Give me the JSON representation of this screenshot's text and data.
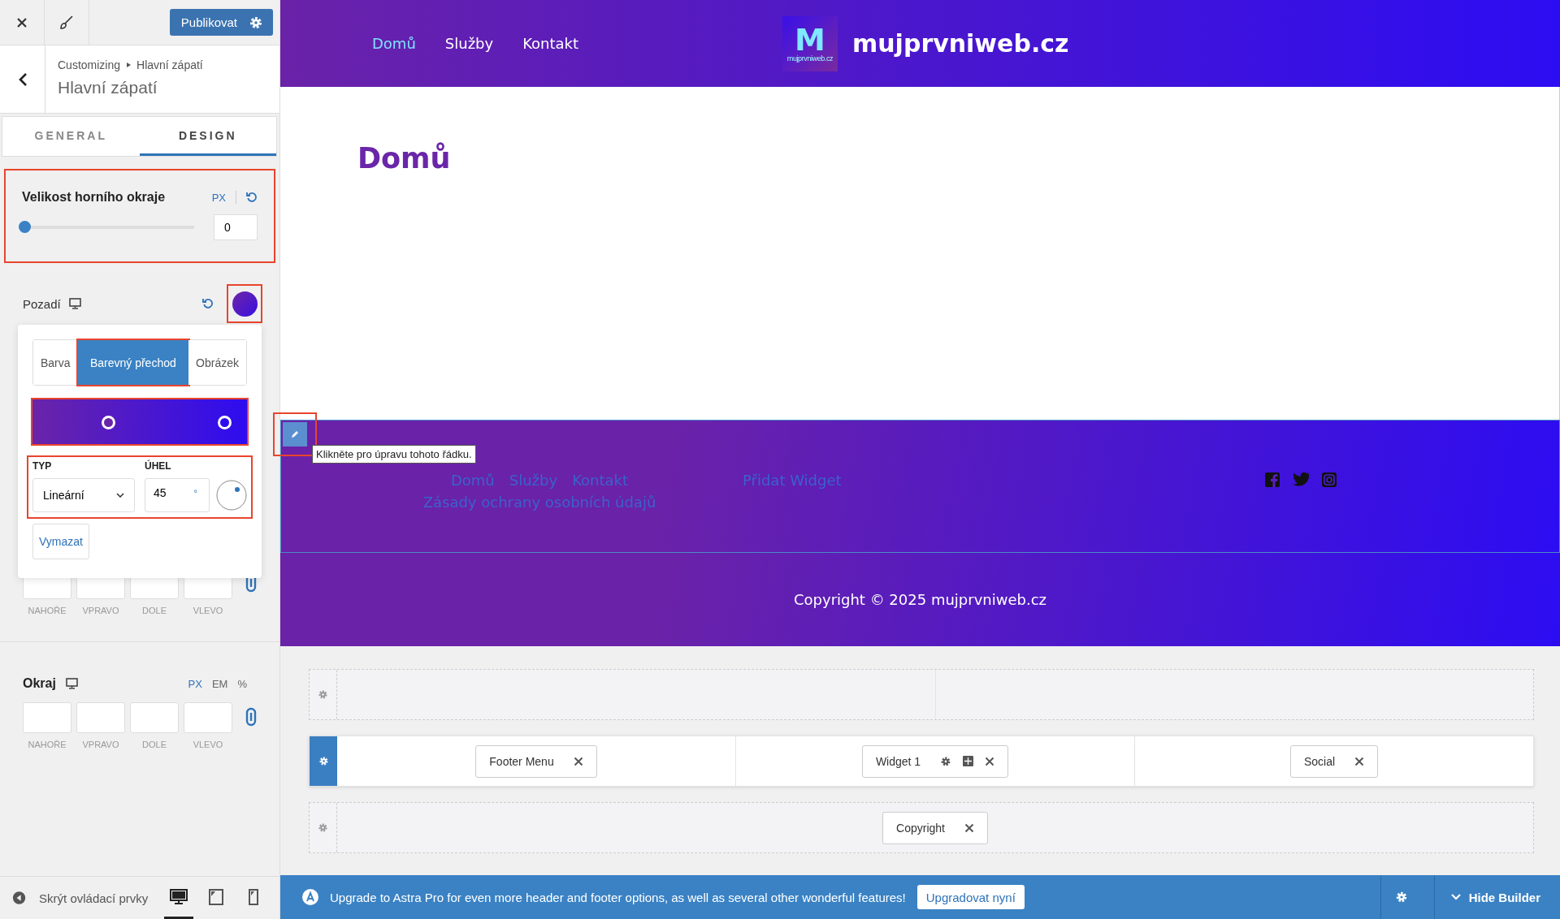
{
  "toolbar": {
    "publish_label": "Publikovat"
  },
  "breadcrumb": {
    "parent": "Customizing",
    "current": "Hlavní zápatí"
  },
  "title": "Hlavní zápatí",
  "tabs": [
    {
      "label": "GENERAL",
      "selected": false
    },
    {
      "label": "DESIGN",
      "selected": true
    }
  ],
  "border_size": {
    "label": "Velikost horního okraje",
    "unit": "PX",
    "value": "0",
    "level": 0,
    "highlighted": true
  },
  "background": {
    "label": "Pozadí",
    "swatch_highlighted": true
  },
  "color_popup": {
    "tabs": [
      {
        "label": "Barva",
        "selected": false,
        "highlighted": false
      },
      {
        "label": "Barevný přechod",
        "selected": true,
        "highlighted": true
      },
      {
        "label": "Obrázek",
        "selected": false,
        "highlighted": false
      }
    ],
    "gradient_highlighted": true,
    "type_label": "TYP",
    "type_value": "Lineární",
    "angle_label": "ÚHEL",
    "angle_value": "45",
    "angle_unit": "°",
    "settings_highlighted": true,
    "clear_label": "Vymazat"
  },
  "padding": {
    "side_labels": [
      "NAHOŘE",
      "VPRAVO",
      "DOLE",
      "VLEVO"
    ]
  },
  "margin": {
    "label": "Okraj",
    "units": [
      {
        "label": "PX",
        "selected": true
      },
      {
        "label": "EM",
        "selected": false
      },
      {
        "label": "%",
        "selected": false
      }
    ],
    "side_labels": [
      "NAHOŘE",
      "VPRAVO",
      "DOLE",
      "VLEVO"
    ]
  },
  "bottom": {
    "hide_label": "Skrýt ovládací prvky",
    "devices": [
      {
        "kind": "desktop",
        "selected": true
      },
      {
        "kind": "tablet",
        "selected": false
      },
      {
        "kind": "mobile",
        "selected": false
      }
    ]
  },
  "site": {
    "nav": [
      {
        "label": "Domů",
        "selected": true
      },
      {
        "label": "Služby",
        "selected": false
      },
      {
        "label": "Kontakt",
        "selected": false
      }
    ],
    "logo_letter": "M",
    "logo_caption": "mujprvniweb.cz",
    "site_title": "mujprvniweb.cz",
    "page_title": "Domů"
  },
  "footer": {
    "edit_highlighted": true,
    "tooltip": "Klikněte pro úpravu tohoto řádku.",
    "menu": [
      "Domů",
      "Služby",
      "Kontakt",
      "Zásady ochrany osobních údajů"
    ],
    "widget": "Přidat Widget",
    "social": [
      {
        "kind": "facebook"
      },
      {
        "kind": "twitter"
      },
      {
        "kind": "instagram"
      }
    ],
    "copyright": "Copyright © 2025 mujprvniweb.cz"
  },
  "builder": {
    "rows": [
      {
        "active": false,
        "columns": [
          {},
          {}
        ]
      },
      {
        "active": true,
        "columns": [
          {
            "items": [
              {
                "label": "Footer Menu",
                "kind": "plain"
              }
            ]
          },
          {
            "items": [
              {
                "label": "Widget 1",
                "kind": "widget"
              }
            ]
          },
          {
            "items": [
              {
                "label": "Social",
                "kind": "plain"
              }
            ]
          }
        ]
      },
      {
        "active": false,
        "columns": [
          {
            "items": [
              {
                "label": "Copyright",
                "kind": "plain"
              }
            ]
          }
        ]
      }
    ]
  },
  "upgrade": {
    "message": "Upgrade to Astra Pro for even more header and footer options, as well as several other wonderful features!",
    "button": "Upgradovat nyní",
    "hide": "Hide Builder"
  }
}
